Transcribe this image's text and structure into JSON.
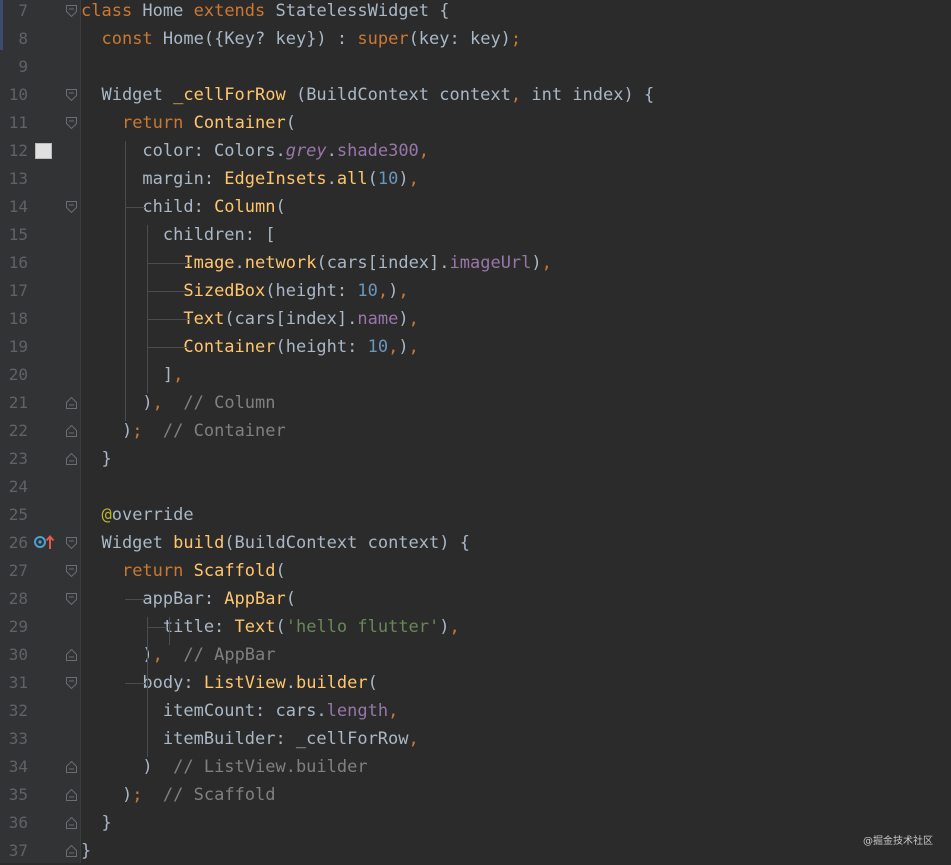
{
  "editor": {
    "lines": [
      {
        "n": "7",
        "tokens": [
          [
            "kw",
            "class"
          ],
          [
            "p",
            " Home "
          ],
          [
            "kw",
            "extends"
          ],
          [
            "p",
            " StatelessWidget {"
          ]
        ]
      },
      {
        "n": "8",
        "tokens": [
          [
            "p",
            "  "
          ],
          [
            "kw",
            "const"
          ],
          [
            "p",
            " Home({Key? key}) : "
          ],
          [
            "kw",
            "super"
          ],
          [
            "p",
            "(key: key)"
          ],
          [
            "kw",
            ";"
          ]
        ]
      },
      {
        "n": "9",
        "tokens": []
      },
      {
        "n": "10",
        "tokens": [
          [
            "p",
            "  Widget "
          ],
          [
            "fn",
            "_cellForRow"
          ],
          [
            "p",
            " (BuildContext context"
          ],
          [
            "kw",
            ","
          ],
          [
            "p",
            " int index) {"
          ]
        ]
      },
      {
        "n": "11",
        "tokens": [
          [
            "p",
            "    "
          ],
          [
            "kw",
            "return"
          ],
          [
            "p",
            " "
          ],
          [
            "ty",
            "Container"
          ],
          [
            "p",
            "("
          ]
        ]
      },
      {
        "n": "12",
        "tokens": [
          [
            "p",
            "      color: Colors."
          ],
          [
            "it",
            "grey"
          ],
          [
            "p",
            "."
          ],
          [
            "fld",
            "shade300"
          ],
          [
            "kw",
            ","
          ]
        ]
      },
      {
        "n": "13",
        "tokens": [
          [
            "p",
            "      margin: "
          ],
          [
            "ty",
            "EdgeInsets"
          ],
          [
            "p",
            "."
          ],
          [
            "fn",
            "all"
          ],
          [
            "p",
            "("
          ],
          [
            "num",
            "10"
          ],
          [
            "p",
            ")"
          ],
          [
            "kw",
            ","
          ]
        ]
      },
      {
        "n": "14",
        "tokens": [
          [
            "p",
            "      child: "
          ],
          [
            "ty",
            "Column"
          ],
          [
            "p",
            "("
          ]
        ]
      },
      {
        "n": "15",
        "tokens": [
          [
            "p",
            "        children: ["
          ]
        ]
      },
      {
        "n": "16",
        "tokens": [
          [
            "p",
            "          "
          ],
          [
            "ty",
            "Image"
          ],
          [
            "p",
            "."
          ],
          [
            "fn",
            "network"
          ],
          [
            "p",
            "(cars[index]."
          ],
          [
            "fld",
            "imageUrl"
          ],
          [
            "p",
            ")"
          ],
          [
            "kw",
            ","
          ]
        ]
      },
      {
        "n": "17",
        "tokens": [
          [
            "p",
            "          "
          ],
          [
            "ty",
            "SizedBox"
          ],
          [
            "p",
            "(height: "
          ],
          [
            "num",
            "10"
          ],
          [
            "kw",
            ","
          ],
          [
            "p",
            ")"
          ],
          [
            "kw",
            ","
          ]
        ]
      },
      {
        "n": "18",
        "tokens": [
          [
            "p",
            "          "
          ],
          [
            "ty",
            "Text"
          ],
          [
            "p",
            "(cars[index]."
          ],
          [
            "fld",
            "name"
          ],
          [
            "p",
            ")"
          ],
          [
            "kw",
            ","
          ]
        ]
      },
      {
        "n": "19",
        "tokens": [
          [
            "p",
            "          "
          ],
          [
            "ty",
            "Container"
          ],
          [
            "p",
            "(height: "
          ],
          [
            "num",
            "10"
          ],
          [
            "kw",
            ","
          ],
          [
            "p",
            ")"
          ],
          [
            "kw",
            ","
          ]
        ]
      },
      {
        "n": "20",
        "tokens": [
          [
            "p",
            "        ]"
          ],
          [
            "kw",
            ","
          ]
        ]
      },
      {
        "n": "21",
        "tokens": [
          [
            "p",
            "      )"
          ],
          [
            "kw",
            ","
          ],
          [
            "p",
            "  "
          ],
          [
            "cmt",
            "// Column"
          ]
        ]
      },
      {
        "n": "22",
        "tokens": [
          [
            "p",
            "    )"
          ],
          [
            "kw",
            ";"
          ],
          [
            "p",
            "  "
          ],
          [
            "cmt",
            "// Container"
          ]
        ]
      },
      {
        "n": "23",
        "tokens": [
          [
            "p",
            "  }"
          ]
        ]
      },
      {
        "n": "24",
        "tokens": []
      },
      {
        "n": "25",
        "tokens": [
          [
            "p",
            "  "
          ],
          [
            "ann",
            "@"
          ],
          [
            "p",
            "override"
          ]
        ]
      },
      {
        "n": "26",
        "tokens": [
          [
            "p",
            "  Widget "
          ],
          [
            "fn",
            "build"
          ],
          [
            "p",
            "(BuildContext context) {"
          ]
        ]
      },
      {
        "n": "27",
        "tokens": [
          [
            "p",
            "    "
          ],
          [
            "kw",
            "return"
          ],
          [
            "p",
            " "
          ],
          [
            "ty",
            "Scaffold"
          ],
          [
            "p",
            "("
          ]
        ]
      },
      {
        "n": "28",
        "tokens": [
          [
            "p",
            "      appBar: "
          ],
          [
            "ty",
            "AppBar"
          ],
          [
            "p",
            "("
          ]
        ]
      },
      {
        "n": "29",
        "tokens": [
          [
            "p",
            "        title: "
          ],
          [
            "ty",
            "Text"
          ],
          [
            "p",
            "("
          ],
          [
            "str",
            "'hello flutter'"
          ],
          [
            "p",
            ")"
          ],
          [
            "kw",
            ","
          ]
        ]
      },
      {
        "n": "30",
        "tokens": [
          [
            "p",
            "      )"
          ],
          [
            "kw",
            ","
          ],
          [
            "p",
            "  "
          ],
          [
            "cmt",
            "// AppBar"
          ]
        ]
      },
      {
        "n": "31",
        "tokens": [
          [
            "p",
            "      body: "
          ],
          [
            "ty",
            "ListView"
          ],
          [
            "p",
            "."
          ],
          [
            "fn",
            "builder"
          ],
          [
            "p",
            "("
          ]
        ]
      },
      {
        "n": "32",
        "tokens": [
          [
            "p",
            "        itemCount: cars."
          ],
          [
            "fld",
            "length"
          ],
          [
            "kw",
            ","
          ]
        ]
      },
      {
        "n": "33",
        "tokens": [
          [
            "p",
            "        itemBuilder: _cellForRow"
          ],
          [
            "kw",
            ","
          ]
        ]
      },
      {
        "n": "34",
        "tokens": [
          [
            "p",
            "      )  "
          ],
          [
            "cmt",
            "// ListView.builder"
          ]
        ]
      },
      {
        "n": "35",
        "tokens": [
          [
            "p",
            "    )"
          ],
          [
            "kw",
            ";"
          ],
          [
            "p",
            "  "
          ],
          [
            "cmt",
            "// Scaffold"
          ]
        ]
      },
      {
        "n": "36",
        "tokens": [
          [
            "p",
            "  }"
          ]
        ]
      },
      {
        "n": "37",
        "tokens": [
          [
            "p",
            "}"
          ]
        ]
      }
    ],
    "fold_open_lines": [
      "7",
      "10",
      "11",
      "14",
      "26",
      "27",
      "28",
      "31"
    ],
    "fold_close_lines": [
      "21",
      "22",
      "23",
      "30",
      "34",
      "35",
      "36",
      "37"
    ],
    "color_swatch": "#e0e0e0",
    "icons": {
      "swatch": "color-swatch-icon",
      "override": "override-method-icon",
      "fold": "fold-icon"
    }
  },
  "watermark": "@掘金技术社区"
}
